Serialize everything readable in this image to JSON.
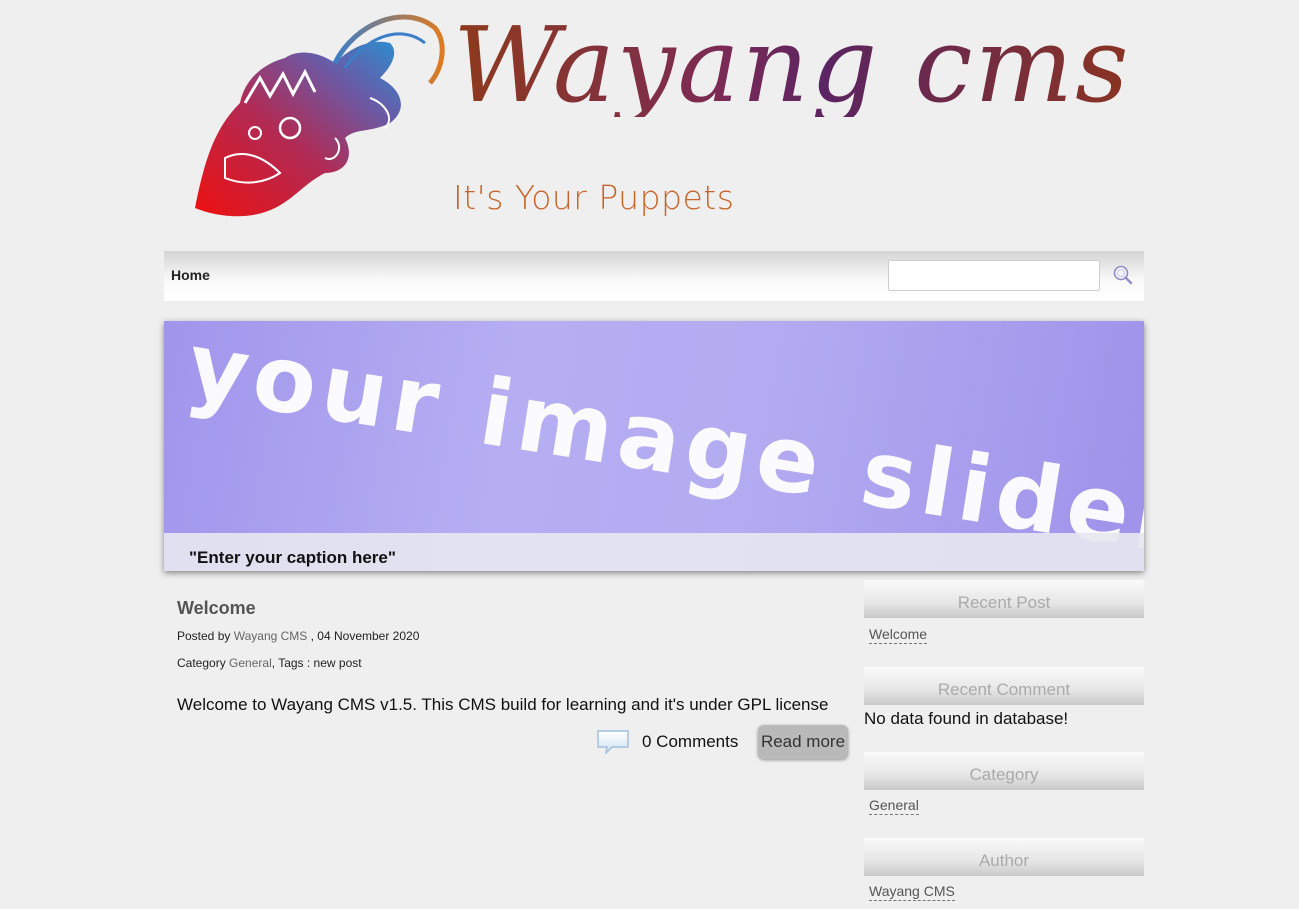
{
  "header": {
    "logo_title": "Wayang cms",
    "logo_tagline": "It's Your Puppets"
  },
  "nav": {
    "home_label": "Home",
    "search_placeholder": "",
    "search_value": ""
  },
  "slider": {
    "art_text": "your image slider",
    "caption": "\"Enter your caption here\""
  },
  "post": {
    "title": "Welcome",
    "posted_by_label": "Posted by",
    "author": "Wayang CMS",
    "date": ", 04 November 2020",
    "category_label": "Category",
    "category": "General",
    "tags_label": ", Tags : new post",
    "body": "Welcome to Wayang CMS v1.5. This CMS build for learning and it's under GPL license",
    "comments": "0 Comments",
    "read_more": "Read more"
  },
  "sidebar": {
    "recent_post": {
      "title": "Recent Post",
      "items": [
        "Welcome"
      ]
    },
    "recent_comment": {
      "title": "Recent Comment",
      "empty_text": "No data found in database!"
    },
    "category": {
      "title": "Category",
      "items": [
        "General"
      ]
    },
    "author": {
      "title": "Author",
      "items": [
        "Wayang CMS"
      ]
    }
  },
  "icons": {
    "search": "search-icon",
    "comment": "comment-bubble-icon",
    "logo": "wayang-puppet-logo"
  }
}
